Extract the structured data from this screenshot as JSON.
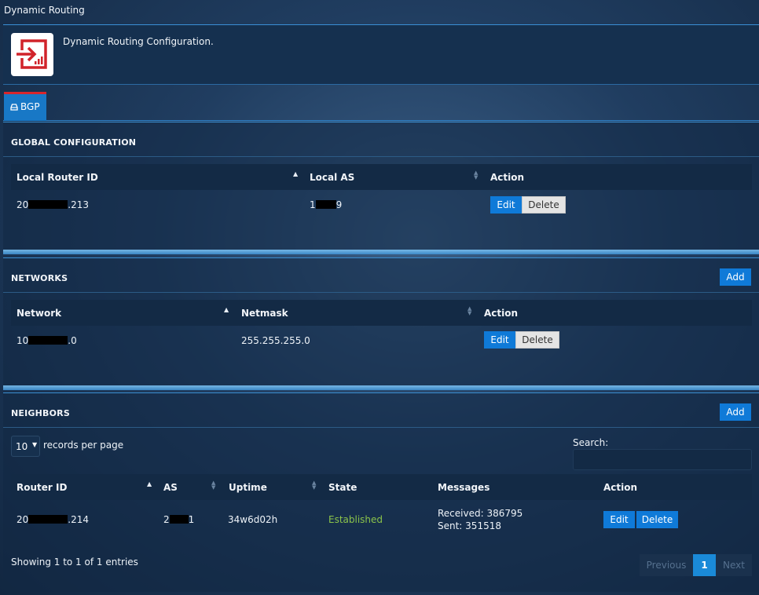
{
  "window": {
    "title": "Dynamic Routing"
  },
  "header": {
    "description": "Dynamic Routing Configuration."
  },
  "tabs": [
    {
      "label": "BGP"
    }
  ],
  "global": {
    "title": "GLOBAL CONFIGURATION",
    "columns": [
      "Local Router ID",
      "Local AS",
      "Action"
    ],
    "row": {
      "router_id_prefix": "20",
      "router_id_suffix": ".213",
      "as_prefix": "1",
      "as_suffix": "9"
    },
    "edit_label": "Edit",
    "delete_label": "Delete"
  },
  "networks": {
    "title": "NETWORKS",
    "add_label": "Add",
    "columns": [
      "Network",
      "Netmask",
      "Action"
    ],
    "row": {
      "network_prefix": "10",
      "network_suffix": ".0",
      "netmask": "255.255.255.0"
    },
    "edit_label": "Edit",
    "delete_label": "Delete"
  },
  "neighbors": {
    "title": "NEIGHBORS",
    "add_label": "Add",
    "page_size": "10",
    "records_label": "records per page",
    "search_label": "Search:",
    "columns": [
      "Router ID",
      "AS",
      "Uptime",
      "State",
      "Messages",
      "Action"
    ],
    "row": {
      "router_id_prefix": "20",
      "router_id_suffix": ".214",
      "as_prefix": "2",
      "as_suffix": "1",
      "uptime": "34w6d02h",
      "state": "Established",
      "received": "Received: 386795",
      "sent": "Sent: 351518"
    },
    "edit_label": "Edit",
    "delete_label": "Delete",
    "info": "Showing 1 to 1 of 1 entries",
    "pagination": {
      "previous": "Previous",
      "current": "1",
      "next": "Next"
    }
  },
  "colors": {
    "accent": "#0f7ad8",
    "state_ok": "#8bc34a",
    "tab_top": "#d8262c",
    "icon_red": "#d1232a"
  }
}
